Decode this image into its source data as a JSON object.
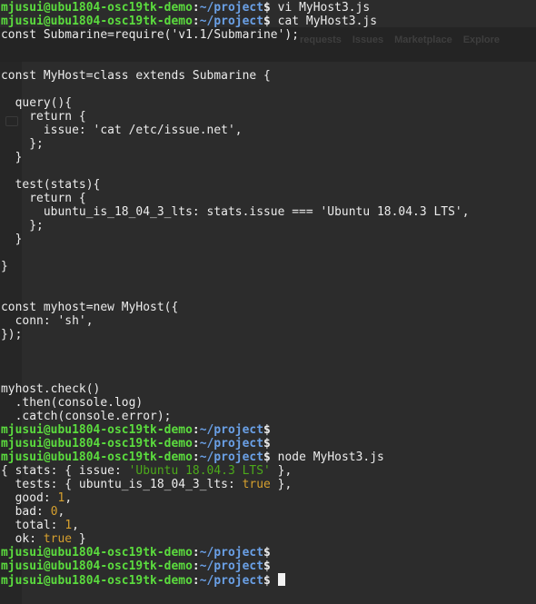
{
  "prompt": {
    "user_host": "mjusui@ubu1804-osc19tk-demo",
    "separator": ":",
    "path": "~/project",
    "symbol": "$"
  },
  "background_nav": [
    "requests",
    "Issues",
    "Marketplace",
    "Explore"
  ],
  "commands": {
    "vi": " vi MyHost3.js",
    "cat": " cat MyHost3.js",
    "node": " node MyHost3.js"
  },
  "file_lines": [
    "const Submarine=require('v1.1/Submarine');",
    "",
    "",
    "const MyHost=class extends Submarine {",
    "",
    "  query(){",
    "    return {",
    "      issue: 'cat /etc/issue.net',",
    "    };",
    "  }",
    "",
    "  test(stats){",
    "    return {",
    "      ubuntu_is_18_04_3_lts: stats.issue === 'Ubuntu 18.04.3 LTS',",
    "    };",
    "  }",
    "",
    "}",
    "",
    "",
    "const myhost=new MyHost({",
    "  conn: 'sh',",
    "});",
    "",
    "",
    "",
    "myhost.check()",
    "  .then(console.log)",
    "  .catch(console.error);"
  ],
  "output": {
    "l1_a": "{ stats: { issue: ",
    "l1_str": "'Ubuntu 18.04.3 LTS'",
    "l1_b": " },",
    "l2_a": "  tests: { ubuntu_is_18_04_3_lts: ",
    "l2_bool": "true",
    "l2_b": " },",
    "l3_a": "  good: ",
    "l3_num": "1",
    "l3_b": ",",
    "l4_a": "  bad: ",
    "l4_num": "0",
    "l4_b": ",",
    "l5_a": "  total: ",
    "l5_num": "1",
    "l5_b": ",",
    "l6_a": "  ok: ",
    "l6_bool": "true",
    "l6_b": " }"
  },
  "colors": {
    "prompt_user": "#5bdc3e",
    "prompt_path": "#6aa0e6",
    "string": "#4caa1a",
    "number": "#d6a02e",
    "text": "#ececec"
  }
}
